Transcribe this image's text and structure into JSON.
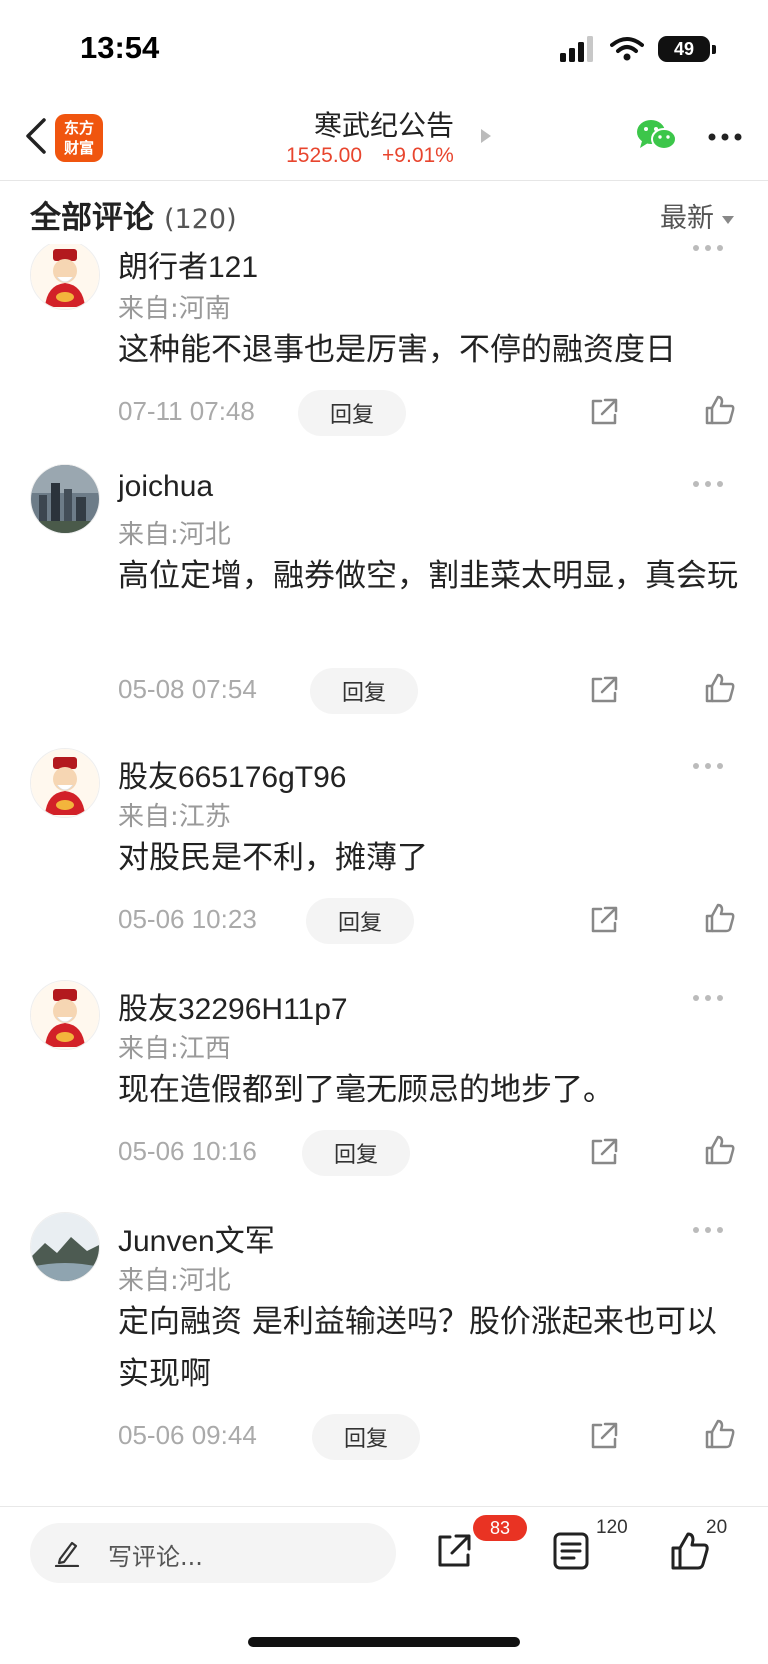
{
  "status_bar": {
    "time": "13:54",
    "battery": "49"
  },
  "nav": {
    "logo_line1": "东方",
    "logo_line2": "财富",
    "title": "寒武纪公告",
    "price": "1525.00",
    "change": "+9.01%"
  },
  "comments_header": {
    "title": "全部评论",
    "count": "(120)",
    "sort": "最新"
  },
  "reply_label": "回复",
  "comments": [
    {
      "user": "朗行者121",
      "location": "来自:河南",
      "text": "这种能不退事也是厉害，不停的融资度日",
      "time": "07-11 07:48"
    },
    {
      "user": "joichua",
      "location": "来自:河北",
      "text": "高位定增，融券做空，割韭菜太明显，真会玩",
      "time": "05-08 07:54"
    },
    {
      "user": "股友665176gT96",
      "location": "来自:江苏",
      "text": "对股民是不利，摊薄了",
      "time": "05-06 10:23"
    },
    {
      "user": "股友32296H11p7",
      "location": "来自:江西",
      "text": "现在造假都到了毫无顾忌的地步了。",
      "time": "05-06 10:16"
    },
    {
      "user": "Junven文军",
      "location": "来自:河北",
      "text": "定向融资 是利益输送吗？股价涨起来也可以实现啊",
      "time": "05-06 09:44"
    }
  ],
  "bottom_bar": {
    "placeholder": "写评论...",
    "share_badge": "83",
    "comments_count": "120",
    "likes_count": "20"
  },
  "colors": {
    "accent_red": "#e8452e",
    "logo_orange": "#f0550f",
    "wechat_green": "#3cc64a"
  }
}
